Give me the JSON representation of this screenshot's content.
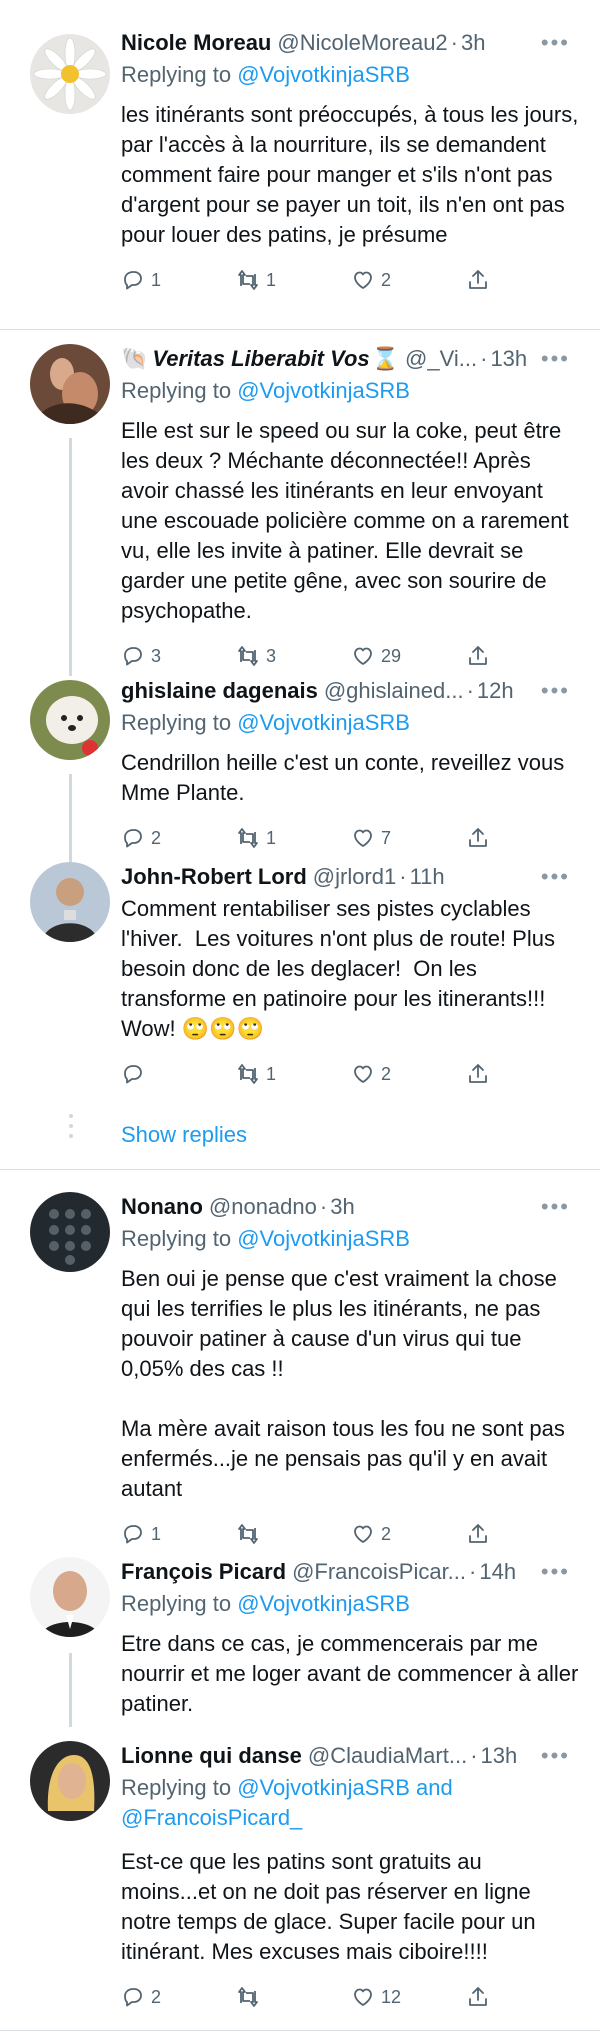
{
  "tweets": [
    {
      "name": "Nicole Moreau",
      "handle": "@NicoleMoreau2",
      "time": "3h",
      "replying_prefix": "Replying to ",
      "replying_to": "@VojvotkinjaSRB",
      "text": "les itinérants sont préoccupés, à tous les jours, par l'accès à la nourriture, ils se demandent comment faire pour manger et s'ils n'ont pas d'argent pour se payer un toit, ils n'en ont pas pour louer des patins, je présume",
      "replies": "1",
      "retweets": "1",
      "likes": "2",
      "avatar": "daisy"
    },
    {
      "name_emoji_before": "🐚",
      "name": "Veritas Liberabit Vos",
      "name_emoji_after": "⌛",
      "handle": "@_Vi...",
      "time": "13h",
      "replying_prefix": "Replying to ",
      "replying_to": "@VojvotkinjaSRB",
      "text": "Elle est sur le speed ou sur la coke, peut être les deux ? Méchante déconnectée!! Après avoir chassé les itinérants en leur envoyant une escouade policière comme on a rarement vu, elle les invite à patiner. Elle devrait se garder une petite gêne, avec son sourire de psychopathe.",
      "replies": "3",
      "retweets": "3",
      "likes": "29",
      "avatar": "painting"
    },
    {
      "name": "ghislaine dagenais",
      "handle": "@ghislained...",
      "time": "12h",
      "replying_prefix": "Replying to ",
      "replying_to": "@VojvotkinjaSRB",
      "text": "Cendrillon heille c'est un conte, reveillez vous Mme Plante.",
      "replies": "2",
      "retweets": "1",
      "likes": "7",
      "avatar": "dog"
    },
    {
      "name": "John-Robert Lord",
      "handle": "@jrlord1",
      "time": "11h",
      "text": "Comment rentabiliser ses pistes cyclables l'hiver.  Les voitures n'ont plus de route! Plus besoin donc de les deglacer!  On les transforme en patinoire pour les itinerants!!! Wow! 🙄🙄🙄",
      "replies": "",
      "retweets": "1",
      "likes": "2",
      "avatar": "man"
    },
    {
      "name": "Nonano",
      "handle": "@nonadno",
      "time": "3h",
      "replying_prefix": "Replying to ",
      "replying_to": "@VojvotkinjaSRB",
      "text": "Ben oui je pense que c'est vraiment la chose qui les terrifies le plus les itinérants, ne pas pouvoir patiner à cause d'un virus qui tue 0,05% des cas !!\n\nMa mère avait raison tous les fou ne sont pas enfermés...je ne pensais pas qu'il y en avait autant",
      "replies": "1",
      "retweets": "",
      "likes": "2",
      "avatar": "phone"
    },
    {
      "name": "François Picard",
      "handle": "@FrancoisPicar...",
      "time": "14h",
      "replying_prefix": "Replying to ",
      "replying_to": "@VojvotkinjaSRB",
      "text": "Etre dans ce cas, je commencerais par me nourrir et me loger avant de commencer à aller patiner.",
      "avatar": "bald"
    },
    {
      "name": "Lionne qui danse",
      "handle": "@ClaudiaMart...",
      "time": "13h",
      "replying_prefix": "Replying to ",
      "replying_to": "@VojvotkinjaSRB",
      "replying_and": " and",
      "replying_to2": "@FrancoisPicard_",
      "text": "Est-ce que les patins sont gratuits au moins...et on ne doit pas réserver en ligne notre temps de glace. Super facile pour un itinérant. Mes excuses mais ciboire!!!!",
      "replies": "2",
      "retweets": "",
      "likes": "12",
      "avatar": "woman"
    }
  ],
  "show_replies_label": "Show replies",
  "icons": {
    "more": "more-horizontal-icon",
    "reply": "reply-icon",
    "retweet": "retweet-icon",
    "like": "heart-icon",
    "share": "share-icon"
  },
  "colors": {
    "link": "#1d9bf0",
    "secondary": "#536471",
    "divider": "#d9dee2",
    "thread": "#cfd9de"
  }
}
